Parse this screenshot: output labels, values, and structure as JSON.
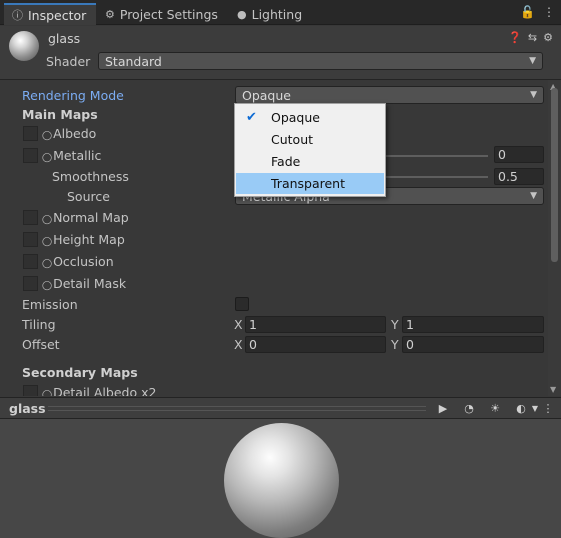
{
  "tabs": [
    {
      "label": "Inspector",
      "icon": "info-icon"
    },
    {
      "label": "Project Settings",
      "icon": "gear-icon"
    },
    {
      "label": "Lighting",
      "icon": "lightbulb-icon"
    }
  ],
  "header": {
    "material_name": "glass",
    "shader_label": "Shader",
    "shader_value": "Standard"
  },
  "properties": {
    "rendering_mode_label": "Rendering Mode",
    "rendering_mode_value": "Opaque",
    "main_maps_label": "Main Maps",
    "albedo_label": "Albedo",
    "metallic_label": "Metallic",
    "metallic_value": "0",
    "smoothness_label": "Smoothness",
    "smoothness_value": "0.5",
    "source_label": "Source",
    "source_value": "Metallic Alpha",
    "normal_map_label": "Normal Map",
    "height_map_label": "Height Map",
    "occlusion_label": "Occlusion",
    "detail_mask_label": "Detail Mask",
    "emission_label": "Emission",
    "tiling_label": "Tiling",
    "tiling_x": "1",
    "tiling_y": "1",
    "offset_label": "Offset",
    "offset_x": "0",
    "offset_y": "0",
    "x_label": "X",
    "y_label": "Y",
    "secondary_maps_label": "Secondary Maps",
    "detail_albedo_label": "Detail Albedo x2"
  },
  "dropdown": {
    "options": [
      "Opaque",
      "Cutout",
      "Fade",
      "Transparent"
    ],
    "selected": "Opaque",
    "highlighted": "Transparent"
  },
  "preview": {
    "title": "glass"
  },
  "colors": {
    "accent": "#3a79bb",
    "label_blue": "#7bacf2",
    "highlight": "#99cbf6"
  }
}
